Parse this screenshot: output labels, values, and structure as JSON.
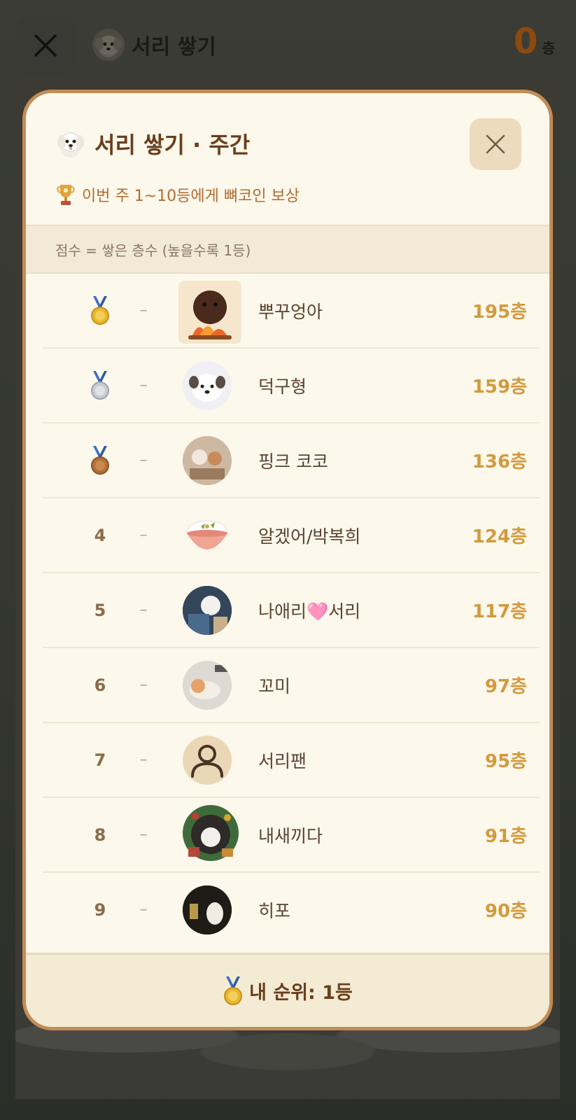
{
  "header": {
    "title": "서리 쌓기",
    "score": "0",
    "score_unit": "층"
  },
  "modal": {
    "title": "서리 쌓기 · 주간",
    "reward_text": "이번 주 1~10등에게 뼈코인 보상",
    "score_rule": "점수 = 쌓은 층수 (높을수록 1등)",
    "rows": [
      {
        "rank": "",
        "medal": "gold",
        "change": "–",
        "name": "뿌꾸엉아",
        "score": "195층",
        "avatar": "campfire-dog"
      },
      {
        "rank": "",
        "medal": "silver",
        "change": "–",
        "name": "덕구형",
        "score": "159층",
        "avatar": "white-dog"
      },
      {
        "rank": "",
        "medal": "bronze",
        "change": "–",
        "name": "핑크 코코",
        "score": "136층",
        "avatar": "dogs-photo"
      },
      {
        "rank": "4",
        "medal": "",
        "change": "–",
        "name": "알겠어/박복희",
        "score": "124층",
        "avatar": "rice-bowl"
      },
      {
        "rank": "5",
        "medal": "",
        "change": "–",
        "name": "나애리🩷서리",
        "score": "117층",
        "avatar": "dog-photo-2"
      },
      {
        "rank": "6",
        "medal": "",
        "change": "–",
        "name": "꼬미",
        "score": "97층",
        "avatar": "dog-photo-3"
      },
      {
        "rank": "7",
        "medal": "",
        "change": "–",
        "name": "서리팬",
        "score": "95층",
        "avatar": "default-user"
      },
      {
        "rank": "8",
        "medal": "",
        "change": "–",
        "name": "내새끼다",
        "score": "91층",
        "avatar": "christmas-dog"
      },
      {
        "rank": "9",
        "medal": "",
        "change": "–",
        "name": "히포",
        "score": "90층",
        "avatar": "dark-dog"
      }
    ],
    "footer": "내 순위: 1등"
  },
  "colors": {
    "accent_brown": "#6a3f1c",
    "score_orange": "#d39a3e",
    "border": "#c28c55",
    "panel_bg": "#fdf8ec"
  }
}
